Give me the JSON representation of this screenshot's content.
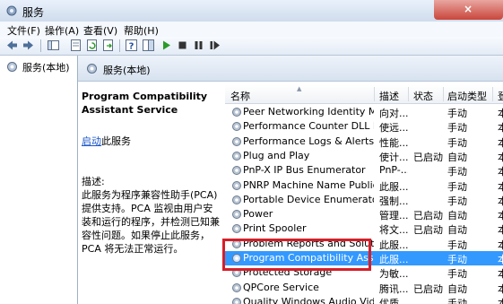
{
  "window": {
    "title": "服务",
    "close_glyph": "×",
    "icon": "services-gear-icon"
  },
  "menu": [
    {
      "label": "文件(F)"
    },
    {
      "label": "操作(A)"
    },
    {
      "label": "查看(V)"
    },
    {
      "label": "帮助(H)"
    }
  ],
  "toolbar": {
    "icons": [
      "back-arrow-icon",
      "forward-arrow-icon",
      "console-tree-icon",
      "properties-icon",
      "refresh-icon",
      "export-icon",
      "help-icon",
      "show-hide-icon",
      "play-icon",
      "stop-icon",
      "pause-icon",
      "restart-icon"
    ],
    "colors": {
      "play": "#2a9b2a",
      "stop": "#333333"
    }
  },
  "tree": {
    "label": "服务(本地)"
  },
  "header": {
    "label": "服务(本地)"
  },
  "details": {
    "service_title": "Program Compatibility Assistant Service",
    "start_link": "启动",
    "start_suffix": "此服务",
    "description_label": "描述:",
    "description_text": "此服务为程序兼容性助手(PCA)提供支持。PCA 监视由用户安装和运行的程序，并检测已知兼容性问题。如果停止此服务，PCA 将无法正常运行。"
  },
  "table": {
    "columns": {
      "name": "名称",
      "description": "描述",
      "status": "状态",
      "startup": "启动类型",
      "extra": "登"
    },
    "rows": [
      {
        "name": "Peer Networking Identity Man...",
        "description": "向对...",
        "status": "",
        "startup": "手动",
        "extra": "本"
      },
      {
        "name": "Performance Counter DLL Host",
        "description": "使远...",
        "status": "",
        "startup": "手动",
        "extra": "本"
      },
      {
        "name": "Performance Logs & Alerts",
        "description": "性能...",
        "status": "",
        "startup": "手动",
        "extra": "本"
      },
      {
        "name": "Plug and Play",
        "description": "使计...",
        "status": "已启动",
        "startup": "自动",
        "extra": "本"
      },
      {
        "name": "PnP-X IP Bus Enumerator",
        "description": "PnP-...",
        "status": "",
        "startup": "手动",
        "extra": "本"
      },
      {
        "name": "PNRP Machine Name Publicati...",
        "description": "此服...",
        "status": "",
        "startup": "手动",
        "extra": "本"
      },
      {
        "name": "Portable Device Enumerator S...",
        "description": "强制...",
        "status": "",
        "startup": "手动",
        "extra": "本"
      },
      {
        "name": "Power",
        "description": "管理...",
        "status": "已启动",
        "startup": "自动",
        "extra": "本"
      },
      {
        "name": "Print Spooler",
        "description": "将文...",
        "status": "已启动",
        "startup": "自动",
        "extra": "本"
      },
      {
        "name": "Problem Reports and Solution...",
        "description": "此服...",
        "status": "",
        "startup": "手动",
        "extra": "本"
      },
      {
        "name": "Program Compatibility Assista...",
        "description": "此服...",
        "status": "",
        "startup": "手动",
        "extra": "本",
        "selected": true
      },
      {
        "name": "Protected Storage",
        "description": "为敏...",
        "status": "",
        "startup": "手动",
        "extra": "本"
      },
      {
        "name": "QPCore Service",
        "description": "腾讯...",
        "status": "已启动",
        "startup": "自动",
        "extra": "本"
      },
      {
        "name": "Quality Windows Audio Video ...",
        "description": "优质...",
        "status": "",
        "startup": "手动",
        "extra": "本"
      }
    ]
  },
  "annotation": {
    "color": "#d61f2a"
  }
}
